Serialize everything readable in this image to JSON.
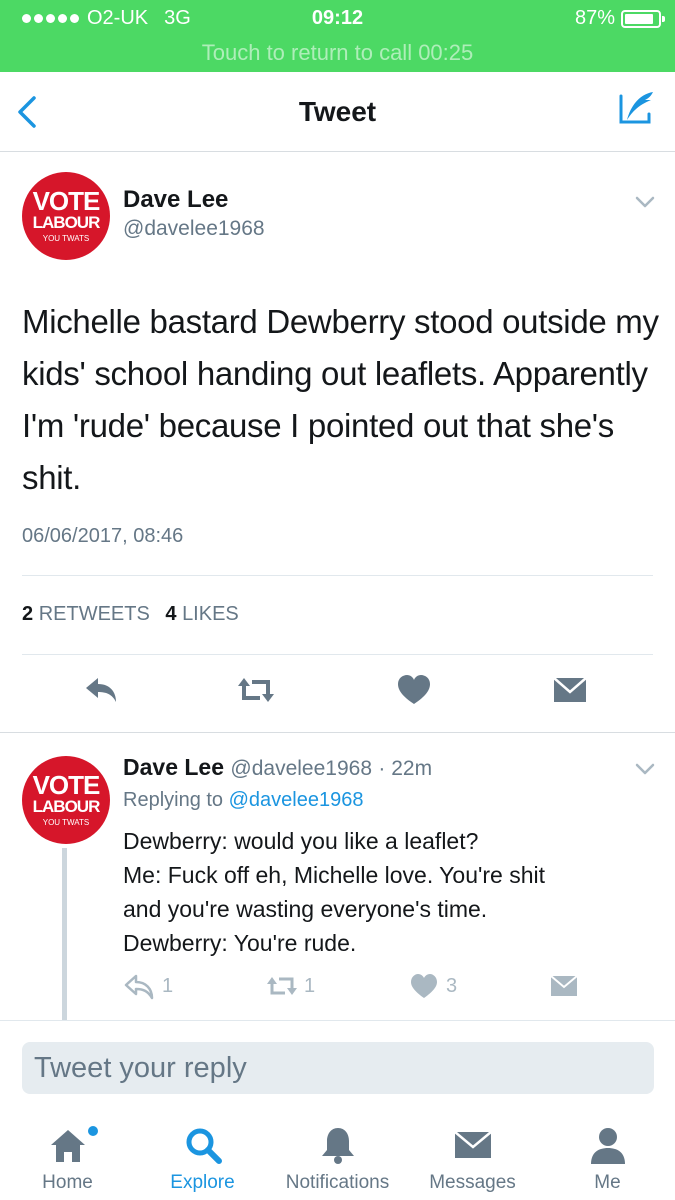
{
  "status": {
    "carrier": "O2-UK",
    "network": "3G",
    "time": "09:12",
    "battery": "87%",
    "call_banner": "Touch to return to call 00:25"
  },
  "nav": {
    "title": "Tweet"
  },
  "avatar": {
    "line1": "VOTE",
    "line2": "LABOUR",
    "line3": "YOU TWATS"
  },
  "tweet": {
    "name": "Dave Lee",
    "handle": "@davelee1968",
    "text": "Michelle bastard Dewberry stood outside my kids' school handing out leaflets. Apparently I'm 'rude' because I pointed out that she's shit.",
    "date": "06/06/2017, 08:46",
    "retweets_count": "2",
    "retweets_label": "RETWEETS",
    "likes_count": "4",
    "likes_label": "LIKES"
  },
  "reply": {
    "name": "Dave Lee",
    "handle": "@davelee1968",
    "time": "· 22m",
    "replying_prefix": "Replying to",
    "replying_to": "@davelee1968",
    "lines": [
      "Dewberry: would you like a leaflet?",
      "Me: Fuck off eh, Michelle love. You're shit",
      "and you're wasting everyone's time.",
      "Dewberry: You're rude."
    ],
    "reply_count": "1",
    "retweet_count": "1",
    "like_count": "3"
  },
  "composer": {
    "placeholder": "Tweet your reply"
  },
  "tabs": [
    {
      "label": "Home",
      "icon": "home-icon"
    },
    {
      "label": "Explore",
      "icon": "search-icon"
    },
    {
      "label": "Notifications",
      "icon": "bell-icon"
    },
    {
      "label": "Messages",
      "icon": "envelope-icon"
    },
    {
      "label": "Me",
      "icon": "person-icon"
    }
  ],
  "colors": {
    "status_green": "#4cd964",
    "accent": "#1b95e0",
    "avatar_red": "#d6162a",
    "muted": "#657786"
  }
}
